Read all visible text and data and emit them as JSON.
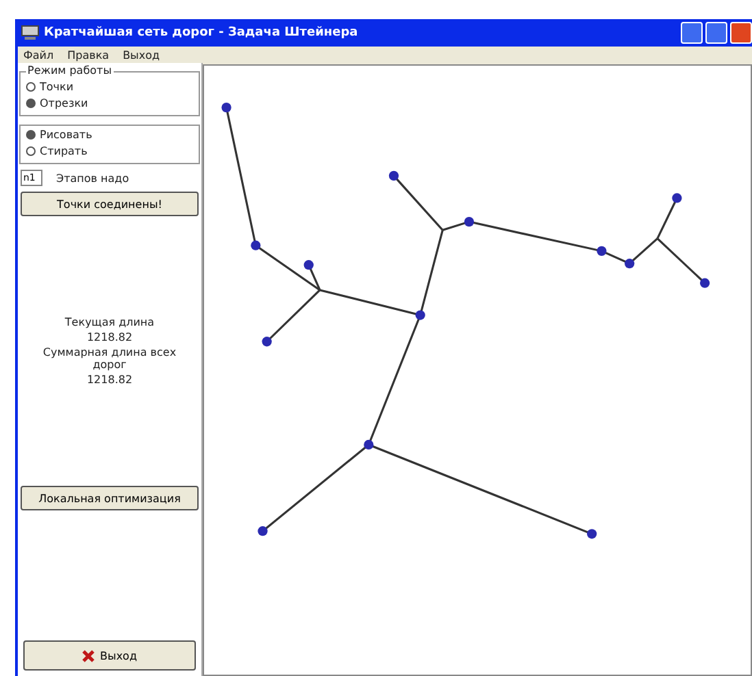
{
  "window": {
    "title": "Кратчайшая сеть дорог - Задача Штейнера"
  },
  "menu": [
    "Файл",
    "Правка",
    "Выход"
  ],
  "mode_group": {
    "title": "Режим работы",
    "options": [
      {
        "label": "Точки",
        "selected": false
      },
      {
        "label": "Отрезки",
        "selected": true
      }
    ]
  },
  "action_group": {
    "options": [
      {
        "label": "Рисовать",
        "selected": true
      },
      {
        "label": "Стирать",
        "selected": false
      }
    ]
  },
  "count": {
    "value": "n1",
    "label": "Этапов надо"
  },
  "connect_button": "Точки соединены!",
  "stats": [
    "Текущая длина",
    "1218.82",
    "Суммарная длина всех дорог",
    "1218.82"
  ],
  "optimize_button": "Локальная оптимизация",
  "exit_button": "Выход"
}
